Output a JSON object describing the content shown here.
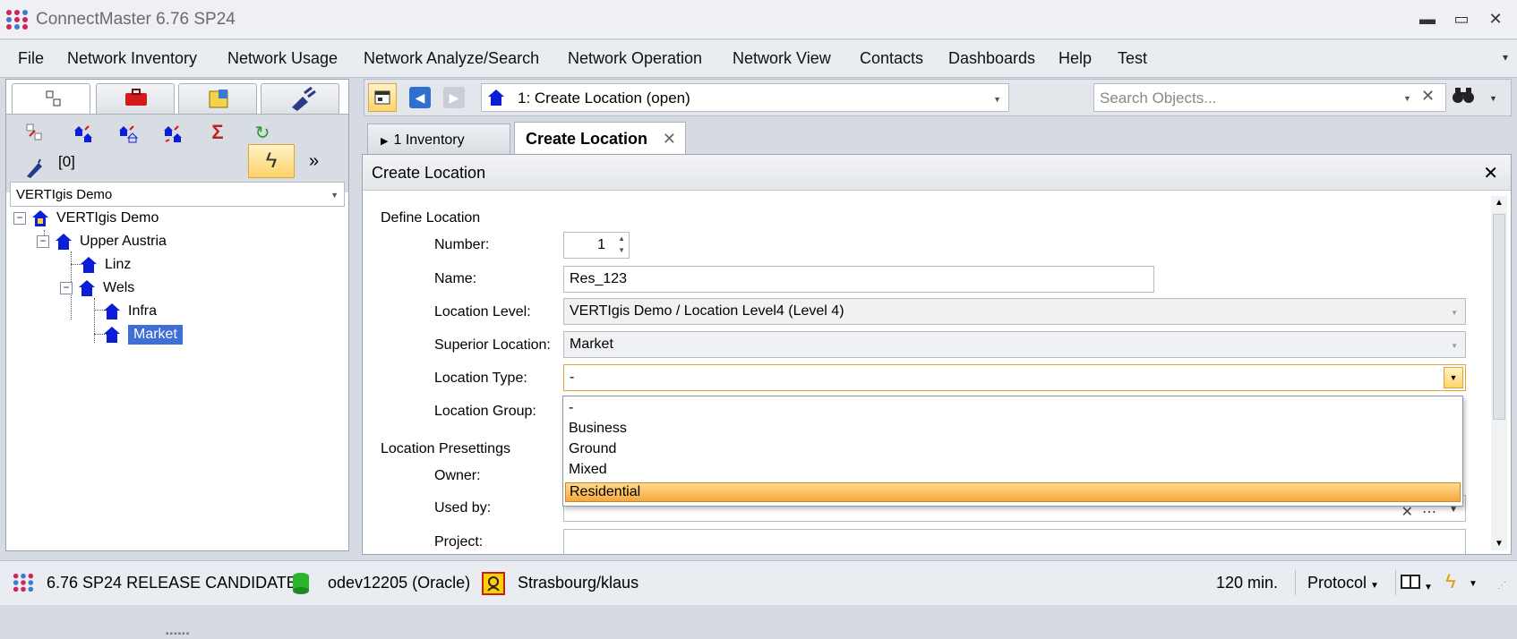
{
  "app": {
    "title": "ConnectMaster 6.76 SP24"
  },
  "window_controls": {
    "minimize": "▬",
    "maximize": "▭",
    "close": "✕"
  },
  "menu": [
    "File",
    "Network Inventory",
    "Network Usage",
    "Network Analyze/Search",
    "Network Operation",
    "Network View",
    "Contacts",
    "Dashboards",
    "Help",
    "Test"
  ],
  "left": {
    "count_label": "[0]",
    "more": "»",
    "scope": "VERTIgis Demo",
    "tree": [
      {
        "label": "VERTIgis Demo"
      },
      {
        "label": "Upper Austria"
      },
      {
        "label": "Linz"
      },
      {
        "label": "Wels"
      },
      {
        "label": "Infra"
      },
      {
        "label": "Market",
        "selected": true
      }
    ]
  },
  "toolbar": {
    "history": "1: Create Location  (open)",
    "search_placeholder": "Search Objects..."
  },
  "tabs": [
    {
      "label": "1 Inventory"
    },
    {
      "label": "Create Location"
    }
  ],
  "dialog": {
    "title": "Create Location",
    "section_define": "Define Location",
    "labels": {
      "number": "Number:",
      "name": "Name:",
      "level": "Location Level:",
      "superior": "Superior Location:",
      "type": "Location Type:",
      "group": "Location Group:",
      "owner": "Owner:",
      "used_by": "Used by:",
      "project": "Project:"
    },
    "values": {
      "number": "1",
      "name": "Res_123",
      "level": "VERTIgis Demo / Location Level4 (Level 4)",
      "superior": "Market",
      "type": "-"
    },
    "section_presettings": "Location Presettings",
    "type_options": [
      "-",
      "Business",
      "Ground",
      "Mixed",
      "Residential"
    ],
    "type_highlighted": "Residential"
  },
  "status": {
    "version": "6.76 SP24 RELEASE CANDIDATE",
    "db": "odev12205 (Oracle)",
    "user": "Strasbourg/klaus",
    "timeout": "120 min.",
    "protocol": "Protocol"
  },
  "colors": {
    "accent": "#f6a840",
    "selection": "#3d6fd6",
    "house": "#0a1ed8"
  }
}
